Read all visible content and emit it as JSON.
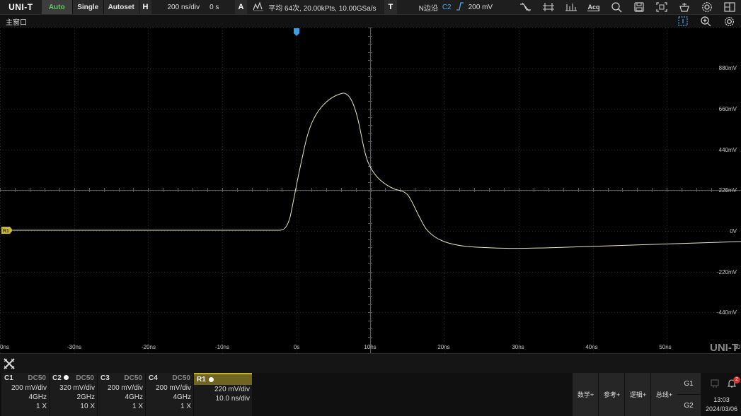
{
  "header": {
    "logo": "UNI-T",
    "auto": "Auto",
    "single": "Single",
    "autoset": "Autoset",
    "h_letter": "H",
    "timebase": "200 ns/div",
    "h_offset": "0 s",
    "a_letter": "A",
    "acq_info": "平均 64次, 20.00kPts, 10.00GSa/s",
    "t_letter": "T",
    "trigger_mode": "N边沿",
    "trigger_source": "C2",
    "trigger_level": "200 mV",
    "acq_label": "Acq"
  },
  "window": {
    "title": "主窗口"
  },
  "y_labels": [
    "880mV",
    "660mV",
    "440mV",
    "220mV",
    "0V",
    "-220mV",
    "-440mV"
  ],
  "x_labels": [
    "0ns",
    "-30ns",
    "-20ns",
    "-10ns",
    "0s",
    "10ns",
    "20ns",
    "30ns",
    "40ns",
    "50ns",
    "60"
  ],
  "ref_marker": "R1",
  "watermark": "UNI-T",
  "channels": [
    {
      "name": "C1",
      "coupling": "DC50",
      "scale": "200 mV/div",
      "bw": "4GHz",
      "probe": "1 X"
    },
    {
      "name": "C2",
      "coupling": "DC50",
      "scale": "320 mV/div",
      "bw": "2GHz",
      "probe": "10 X"
    },
    {
      "name": "C3",
      "coupling": "DC50",
      "scale": "200 mV/div",
      "bw": "4GHz",
      "probe": "1 X"
    },
    {
      "name": "C4",
      "coupling": "DC50",
      "scale": "200 mV/div",
      "bw": "4GHz",
      "probe": "1 X"
    }
  ],
  "ref": {
    "name": "R1",
    "scale": "220 mV/div",
    "timebase": "10.0 ns/div"
  },
  "menu": {
    "math": "数学+",
    "ref": "参考+",
    "logic": "逻辑+",
    "bus": "总线+"
  },
  "g1": "G1",
  "g2": "G2",
  "notification_count": "2",
  "time": "13:03",
  "date": "2024/03/06",
  "colors": {
    "trace": "#e9e6c4",
    "ref_marker": "#c8b63a",
    "trigger_marker": "#3aa0e6",
    "auto": "#5fc95f"
  }
}
